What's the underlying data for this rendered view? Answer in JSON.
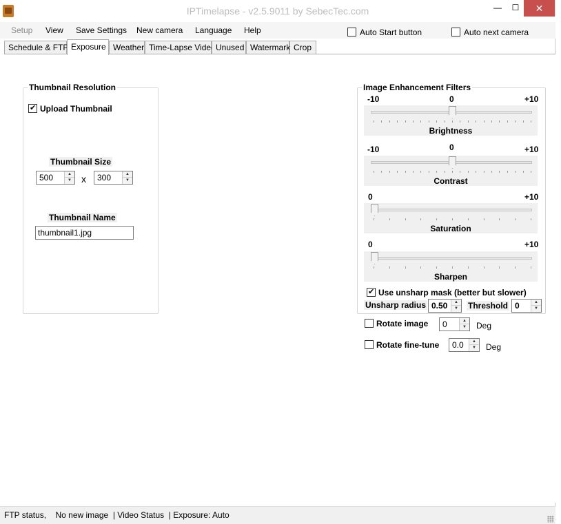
{
  "window": {
    "title": "IPTimelapse - v2.5.9011 by SebecTec.com",
    "minimize_glyph": "—",
    "maximize_glyph": "☐",
    "close_glyph": "✕"
  },
  "menu": {
    "items": [
      "Setup",
      "View",
      "Save Settings",
      "New camera",
      "Language",
      "Help"
    ],
    "auto_start": {
      "label": "Auto Start button",
      "checked": false
    },
    "auto_next": {
      "label": "Auto next camera",
      "checked": false
    }
  },
  "tabs": [
    "Schedule & FTP",
    "Exposure",
    "Weather",
    "Time-Lapse Video",
    "Unused",
    "Watermark",
    "Crop"
  ],
  "active_tab": "Exposure",
  "thumbnail": {
    "group_title": "Thumbnail Resolution",
    "upload_label": "Upload Thumbnail",
    "upload_checked": true,
    "size_label": "Thumbnail Size",
    "width": "500",
    "separator": "x",
    "height": "300",
    "name_label": "Thumbnail Name",
    "name_value": "thumbnail1.jpg"
  },
  "filters": {
    "group_title": "Image Enhancement Filters",
    "brightness": {
      "name": "Brightness",
      "min": "-10",
      "mid": "0",
      "max": "+10",
      "value": 0,
      "range": [
        -10,
        10
      ]
    },
    "contrast": {
      "name": "Contrast",
      "min": "-10",
      "mid": "0",
      "max": "+10",
      "value": 0,
      "range": [
        -10,
        10
      ]
    },
    "saturation": {
      "name": "Saturation",
      "min": "0",
      "max": "+10",
      "value": 0,
      "range": [
        0,
        10
      ]
    },
    "sharpen": {
      "name": "Sharpen",
      "min": "0",
      "max": "+10",
      "value": 0,
      "range": [
        0,
        10
      ]
    },
    "unsharp": {
      "label": "Use unsharp mask (better but slower)",
      "checked": true
    },
    "unsharp_radius_label": "Unsharp radius",
    "unsharp_radius": "0.50",
    "threshold_label": "Threshold",
    "threshold": "0"
  },
  "rotate": {
    "rotate_label": "Rotate image",
    "rotate_checked": false,
    "rotate_value": "0",
    "rotate_unit": "Deg",
    "fine_label": "Rotate fine-tune",
    "fine_checked": false,
    "fine_value": "0.0",
    "fine_unit": "Deg"
  },
  "status": {
    "text": "FTP status,    No new image  | Video Status  | Exposure: Auto"
  }
}
